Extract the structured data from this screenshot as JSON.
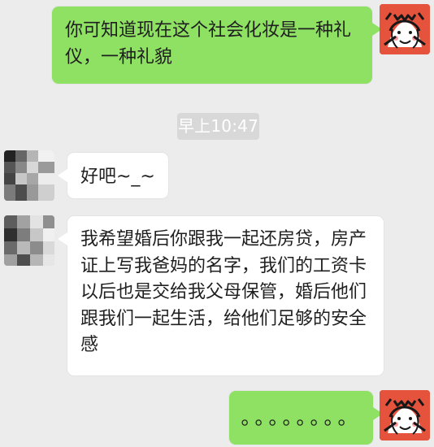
{
  "chat": {
    "timestamp": "早上10:47",
    "messages": [
      {
        "sender": "self",
        "text": "你可知道现在这个社会化妆是一种礼仪，一种礼貌"
      },
      {
        "sender": "other",
        "text": "好吧~_~"
      },
      {
        "sender": "other",
        "text": "我希望婚后你跟我一起还房贷，房产证上写我爸妈的名字，我们的工资卡以后也是交给我父母保管，婚后他们跟我们一起生活，给他们足够的安全感"
      },
      {
        "sender": "self",
        "text": "。。。。。。。。"
      }
    ]
  },
  "colors": {
    "background": "#ececec",
    "self_bubble": "#8ee163",
    "other_bubble": "#ffffff",
    "timestamp_bg": "#d8d8d8",
    "timestamp_text": "#ffffff",
    "avatar_self_bg": "#e6533d",
    "avatar_other_bg": "#cfcfcf"
  },
  "icons": {
    "self_avatar": "cartoon-avatar",
    "other_avatar": "pixelated-avatar"
  }
}
